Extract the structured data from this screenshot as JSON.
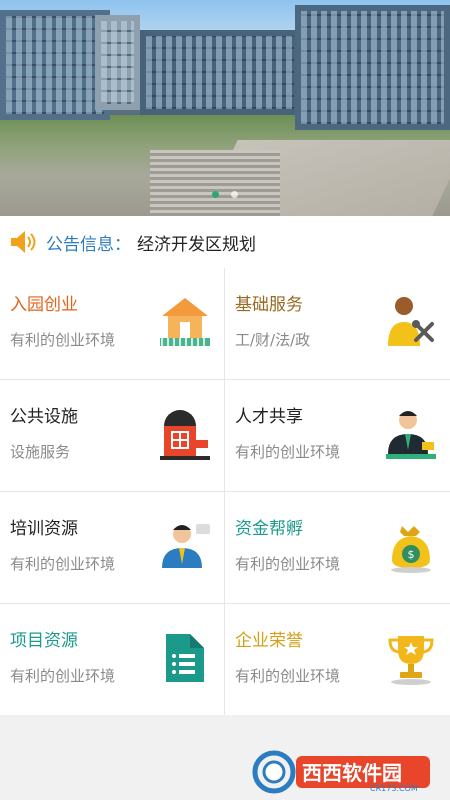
{
  "banner": {
    "slides_count": 2,
    "active_slide": 1
  },
  "notice": {
    "label": "公告信息：",
    "text": "经济开发区规划",
    "icon": "speaker-icon"
  },
  "colors": {
    "notice_label": "#2b7cc0",
    "title_orange": "#e0641a",
    "title_brown": "#9b6a22",
    "title_teal": "#1b9a8c",
    "title_gold": "#d4a017",
    "subtitle": "#8a8a8a"
  },
  "services": [
    {
      "title": "入园创业",
      "subtitle": "有利的创业环境",
      "icon": "house-icon"
    },
    {
      "title": "基础服务",
      "subtitle": "工/财/法/政",
      "icon": "worker-tools-icon"
    },
    {
      "title": "公共设施",
      "subtitle": "设施服务",
      "icon": "facility-building-icon"
    },
    {
      "title": "人才共享",
      "subtitle": "有利的创业环境",
      "icon": "talent-person-icon"
    },
    {
      "title": "培训资源",
      "subtitle": "有利的创业环境",
      "icon": "trainer-icon"
    },
    {
      "title": "资金帮孵",
      "subtitle": "有利的创业环境",
      "icon": "money-bag-icon"
    },
    {
      "title": "项目资源",
      "subtitle": "有利的创业环境",
      "icon": "document-list-icon"
    },
    {
      "title": "企业荣誉",
      "subtitle": "有利的创业环境",
      "icon": "trophy-icon"
    }
  ],
  "watermark": {
    "text": "西西软件园",
    "domain": "CR173.COM"
  }
}
